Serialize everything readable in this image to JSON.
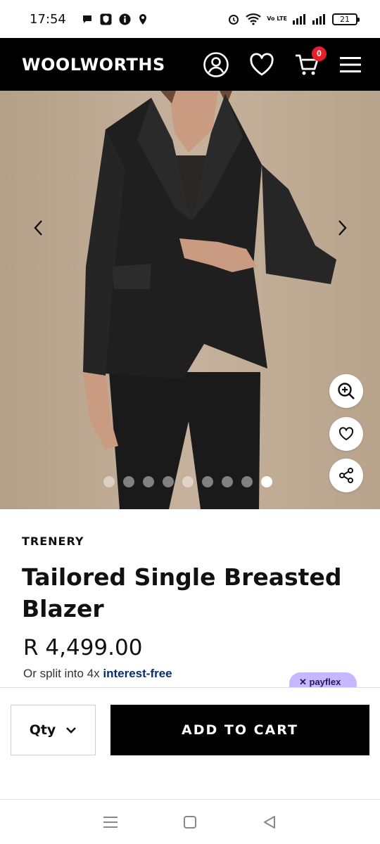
{
  "status_bar": {
    "time": "17:54",
    "battery": "21",
    "icons_left": [
      "chat-bubble-icon",
      "shield-app-icon",
      "info-app-icon",
      "location-icon"
    ],
    "icons_right": [
      "alarm-icon",
      "wifi-icon",
      "volte-icon",
      "signal-icon",
      "signal-icon",
      "battery-icon"
    ],
    "volte_label": "Vo LTE"
  },
  "header": {
    "logo": "WOOLWORTHS",
    "icons": [
      "account-icon",
      "wishlist-heart-icon",
      "cart-icon",
      "menu-icon"
    ],
    "cart_count": "0"
  },
  "gallery": {
    "image_alt": "Model wearing black tailored single breasted blazer and trousers",
    "dot_count": 9,
    "active_dot": 9,
    "buttons": [
      "zoom-in-icon",
      "heart-icon",
      "share-icon"
    ]
  },
  "product": {
    "brand": "TRENERY",
    "title": "Tailored Single Breasted Blazer",
    "price": "R 4,499.00",
    "split_text": "Or split into 4x ",
    "split_link": "interest-free",
    "payflex_label": "payflex"
  },
  "actions": {
    "qty_label": "Qty",
    "add_to_cart": "ADD TO CART"
  },
  "colors": {
    "header_bg": "#000000",
    "cart_badge": "#e4202a",
    "link": "#0c2b6b",
    "payflex_bg": "#c8b6ff",
    "gallery_bg": "#c1ad97"
  }
}
